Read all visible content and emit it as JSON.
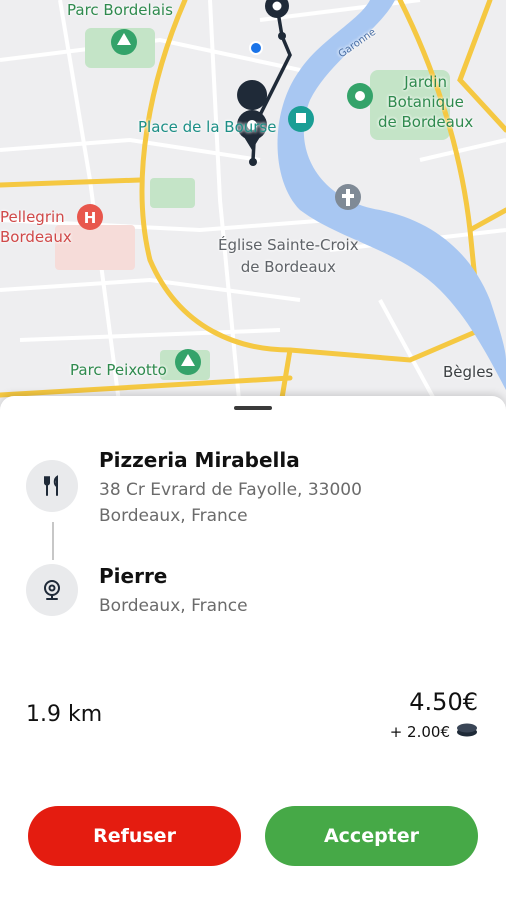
{
  "map": {
    "labels": {
      "parc_bordelais": "Parc Bordelais",
      "place_de_la_bourse": "Place de la Bourse",
      "jardin_botanique": "Jardin\nBotanique\nde Bordeaux",
      "pellegrin": "Pellegrin\nBordeaux",
      "eglise": "Église Sainte-Croix\nde Bordeaux",
      "parc_peixotto": "Parc Peixotto",
      "begles": "Bègles",
      "garonne": "Garonne"
    },
    "colors": {
      "river": "#a8c7f2",
      "road_major": "#f5c842",
      "road_minor": "#ffffff",
      "park": "#c4e4c7",
      "route": "#1f2a38"
    }
  },
  "order": {
    "pickup": {
      "icon": "utensils-icon",
      "name": "Pizzeria Mirabella",
      "address": "38 Cr Evrard de Fayolle, 33000 Bordeaux, France"
    },
    "dropoff": {
      "icon": "location-pin-icon",
      "name": "Pierre",
      "address": "Bordeaux, France"
    },
    "distance": "1.9 km",
    "price": "4.50€",
    "tip": "+ 2.00€",
    "tip_icon": "coins-icon"
  },
  "actions": {
    "refuse_label": "Refuser",
    "accept_label": "Accepter",
    "refuse_color": "#e41c10",
    "accept_color": "#46a947"
  }
}
